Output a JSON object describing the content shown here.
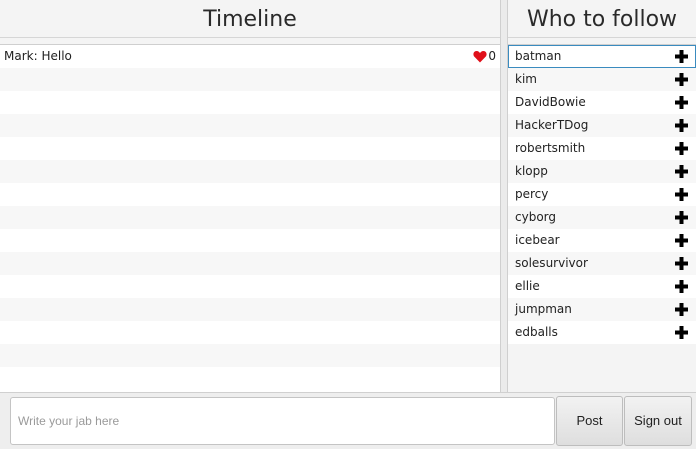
{
  "timeline": {
    "title": "Timeline",
    "posts": [
      {
        "text": "Mark: Hello",
        "likes": "0",
        "icon": "heart-icon"
      }
    ],
    "empty_rows": 14
  },
  "follow": {
    "title": "Who to follow",
    "users": [
      "batman",
      "kim",
      "DavidBowie",
      "HackerTDog",
      "robertsmith",
      "klopp",
      "percy",
      "cyborg",
      "icebear",
      "solesurvivor",
      "ellie",
      "jumpman",
      "edballs"
    ],
    "selected_index": 0,
    "add_icon": "plus-icon"
  },
  "composer": {
    "placeholder": "Write your jab here",
    "value": "",
    "post_label": "Post",
    "signout_label": "Sign out"
  },
  "colors": {
    "heart": "#e0101a",
    "selection": "#3a8bbf"
  }
}
